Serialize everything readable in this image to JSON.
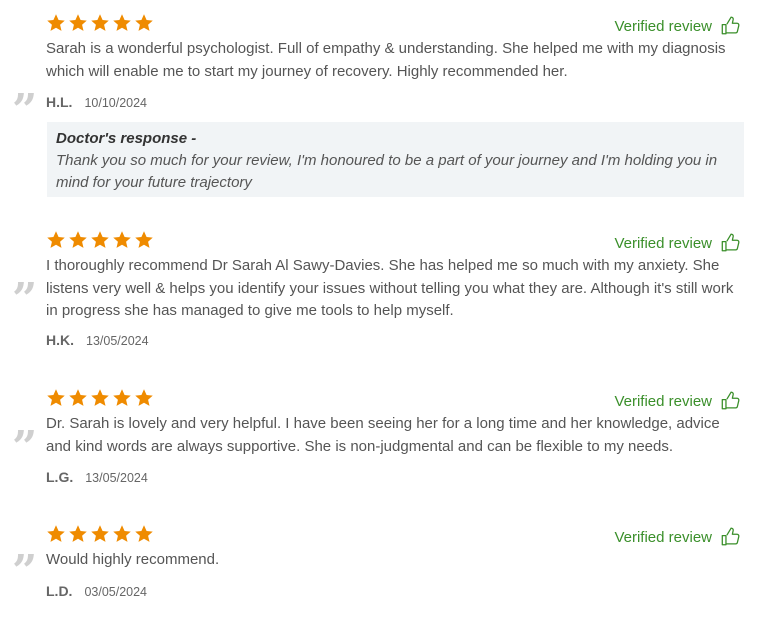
{
  "colors": {
    "star": "#ef8b00",
    "verified": "#3a8f2a",
    "text": "#555555",
    "response_bg": "#f1f4f6"
  },
  "reviews": [
    {
      "rating": 5,
      "verified_label": "Verified review",
      "text": "Sarah is a wonderful psychologist. Full of empathy & understanding. She helped me with my diagnosis which will enable me to start my journey of recovery. Highly recommended her.",
      "initials": "H.L.",
      "date": "10/10/2024",
      "response": {
        "title": "Doctor's response -",
        "text": "Thank you so much for your review, I'm honoured to be a part of your journey and I'm holding you in mind for your future trajectory"
      }
    },
    {
      "rating": 5,
      "verified_label": "Verified review",
      "text": "I thoroughly recommend Dr Sarah Al Sawy-Davies. She has helped me so much with my anxiety. She listens very well & helps you identify your issues without telling you what they are. Although it's still work in progress she has managed to give me tools to help myself.",
      "initials": "H.K.",
      "date": "13/05/2024"
    },
    {
      "rating": 5,
      "verified_label": "Verified review",
      "text": "Dr. Sarah is lovely and very helpful. I have been seeing her for a long time and her knowledge, advice and kind words are always supportive. She is non-judgmental and can be flexible to my needs.",
      "initials": "L.G.",
      "date": "13/05/2024"
    },
    {
      "rating": 5,
      "verified_label": "Verified review",
      "text": "Would highly recommend.",
      "initials": "L.D.",
      "date": "03/05/2024"
    }
  ],
  "icons": {
    "star": "star-icon",
    "thumb": "thumbs-up-icon",
    "quote": "quote-mark-icon"
  }
}
